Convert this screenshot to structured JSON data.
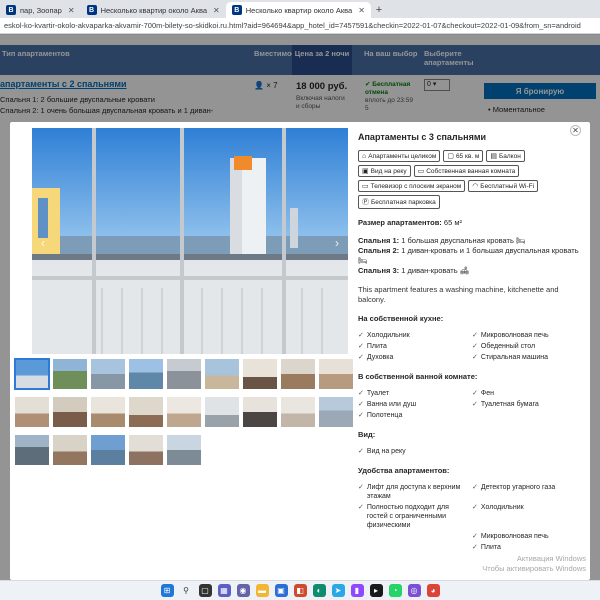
{
  "browser": {
    "tabs": [
      {
        "label": "пар, Зоопар",
        "active": false
      },
      {
        "label": "Несколько квартир около Аква",
        "active": false
      },
      {
        "label": "Несколько квартир около Аква",
        "active": true
      }
    ],
    "url": "eskol-ko-kvartir-okolo-akvaparka-akvamir-700m-bilety-so-skidkoi.ru.html?aid=964694&app_hotel_id=7457591&checkin=2022-01-07&checkout=2022-01-09&from_sn=android"
  },
  "background": {
    "headers": [
      "Тип апартаментов",
      "Вместимость",
      "Цена за 2 ночи",
      "На ваш выбор",
      "Выберите апартаменты"
    ],
    "room_title": "апартаменты с 2 спальнями",
    "bed1": "Спальня 1: 2 большие двуспальные кровати",
    "bed2": "Спальня 2: 1 очень большая двуспальная кровать и 1 диван-",
    "guests": "× 7",
    "price": "18 000 руб.",
    "price_note": "Включая налоги и сборы",
    "cancel": "Бесплатная отмена",
    "cancel_note": "вплоть до 23:59 5",
    "select_value": "0",
    "book_button": "Я бронирую",
    "bullet": "• Моментальное"
  },
  "modal": {
    "title": "Апартаменты с 3 спальнями",
    "chips": [
      {
        "icon": "⌂",
        "label": "Апартаменты целиком"
      },
      {
        "icon": "▢",
        "label": "65 кв. м"
      },
      {
        "icon": "▤",
        "label": "Балкон"
      },
      {
        "icon": "▣",
        "label": "Вид на реку"
      },
      {
        "icon": "▭",
        "label": "Собственная ванная комната"
      },
      {
        "icon": "▭",
        "label": "Телевизор с плоским экраном"
      },
      {
        "icon": "◠",
        "label": "Бесплатный Wi-Fi"
      },
      {
        "icon": "Ⓟ",
        "label": "Бесплатная парковка"
      }
    ],
    "size_label": "Размер апартаментов:",
    "size_value": "65 м²",
    "beds": [
      {
        "label": "Спальня 1:",
        "text": "1 большая двуспальная кровать"
      },
      {
        "label": "Спальня 2:",
        "text": "1 диван-кровать и 1 большая двуспальная кровать"
      },
      {
        "label": "Спальня 3:",
        "text": "1 диван-кровать"
      }
    ],
    "description": "This apartment features a washing machine, kitchenette and balcony.",
    "sections": [
      {
        "title": "На собственной кухне:",
        "cols": 2,
        "items": [
          "Холодильник",
          "Микроволновая печь",
          "Плита",
          "Обеденный стол",
          "Духовка",
          "Стиральная машина"
        ]
      },
      {
        "title": "В собственной ванной комнате:",
        "cols": 2,
        "items": [
          "Туалет",
          "Фен",
          "Ванна или душ",
          "Туалетная бумага",
          "Полотенца"
        ]
      },
      {
        "title": "Вид:",
        "cols": 1,
        "items": [
          "Вид на реку"
        ]
      },
      {
        "title": "Удобства апартаментов:",
        "cols": 2,
        "items": [
          "Лифт для доступа к верхним этажам",
          "Детектор угарного газа",
          "Полностью подходит для гостей с ограниченными физическими",
          "Холодильник",
          "",
          "Микроволновая печь",
          "",
          "Плита"
        ]
      }
    ],
    "watermark_line1": "Активация Windows",
    "watermark_line2": "Чтобы активировать Windows"
  },
  "colors": {
    "brand_blue": "#003580",
    "link_blue": "#0071c2",
    "header_blue": "#4a70a8",
    "success_green": "#008009"
  }
}
